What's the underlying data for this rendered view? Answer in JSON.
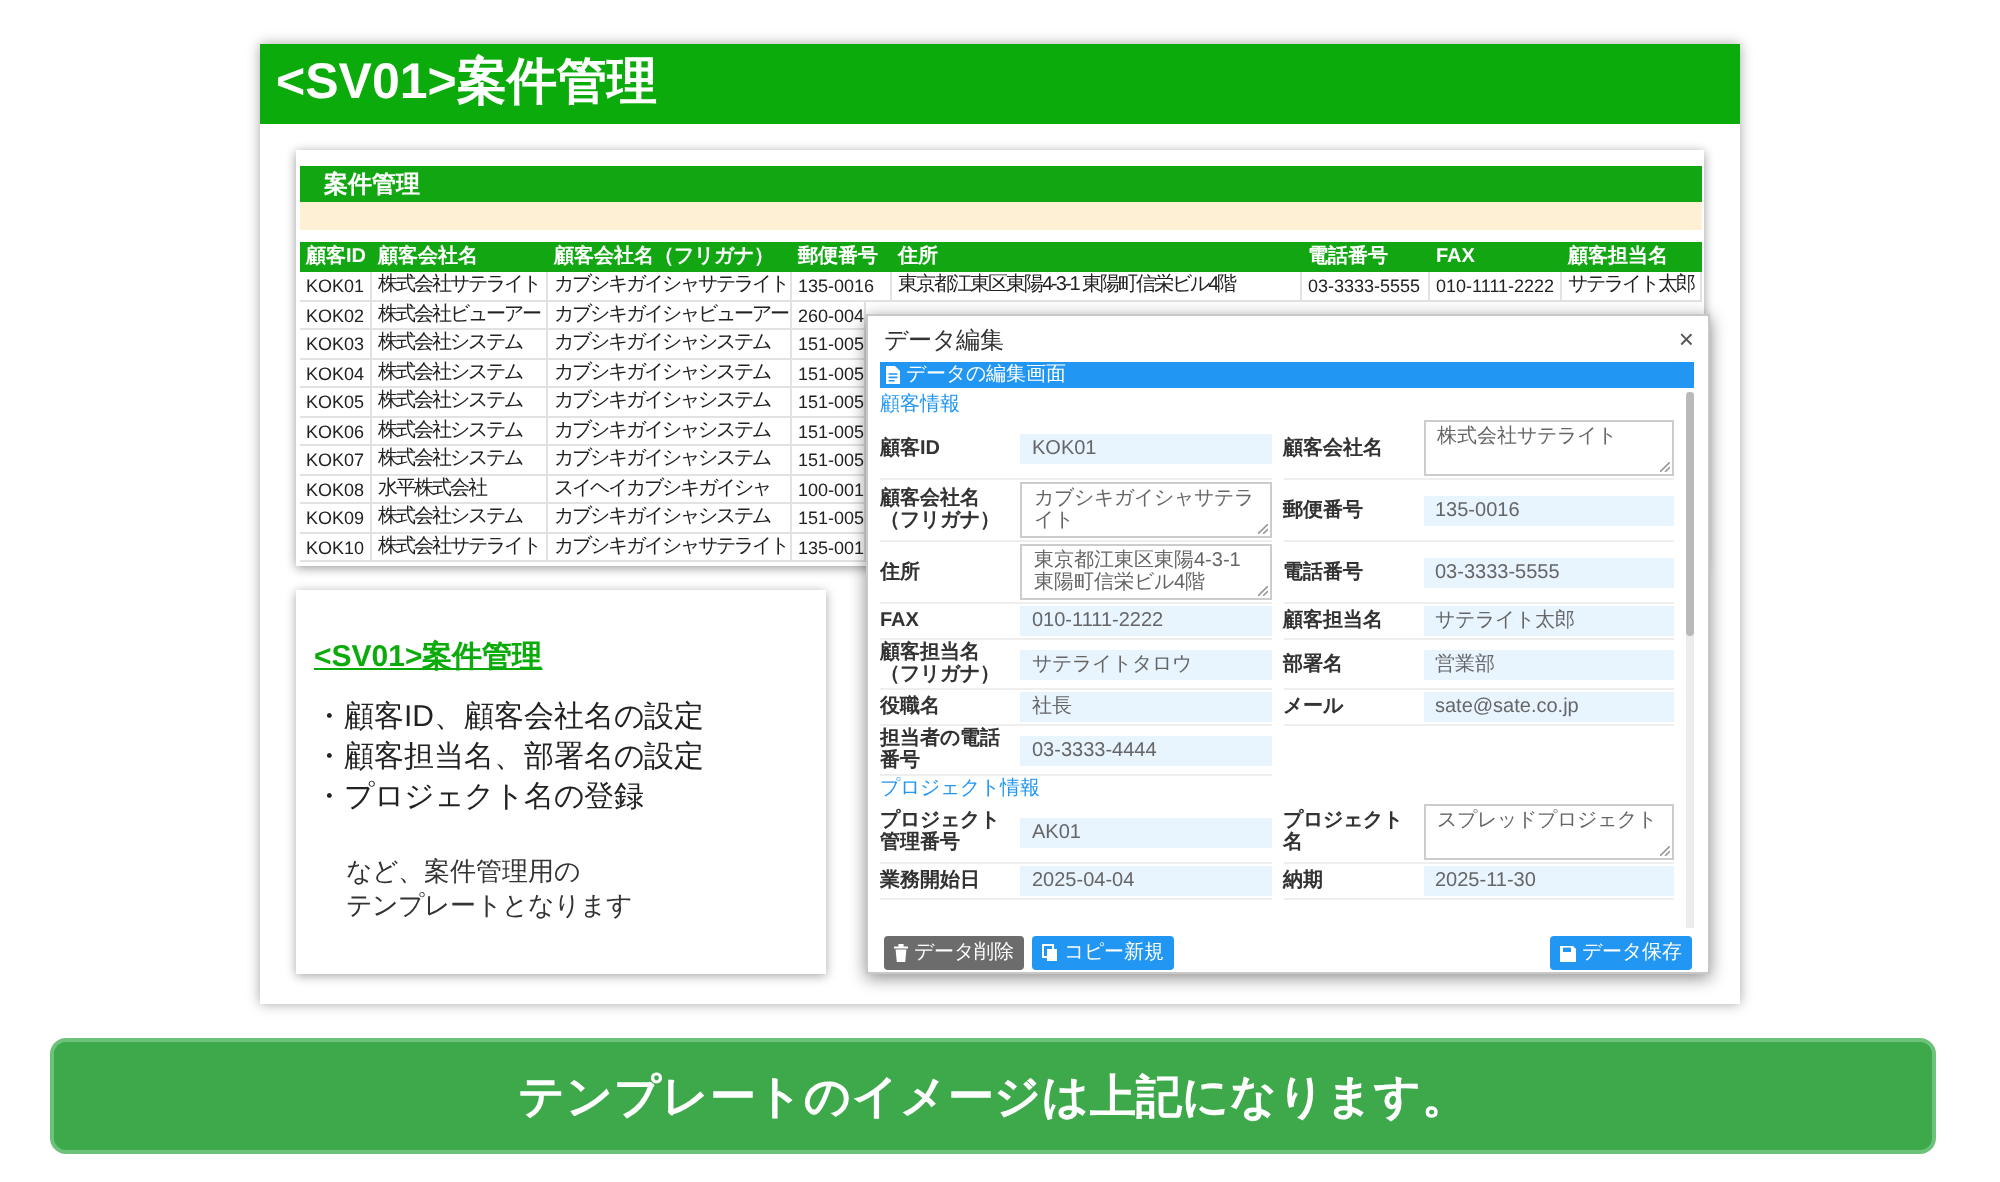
{
  "header": {
    "title": "<SV01>案件管理"
  },
  "sheet": {
    "title": "案件管理",
    "columns": [
      "顧客ID",
      "顧客会社名",
      "顧客会社名（フリガナ）",
      "郵便番号",
      "住所",
      "電話番号",
      "FAX",
      "顧客担当名"
    ],
    "rows": [
      {
        "cells": [
          "KOK01",
          "株式会社サテライト",
          "カブシキガイシャサテライト",
          "135-0016",
          "東京都江東区東陽4-3-1 東陽町信栄ビル4階",
          "03-3333-5555",
          "010-1111-2222",
          "サテライト太郎"
        ]
      },
      {
        "cells": [
          "KOK02",
          "株式会社ビューアー",
          "カブシキガイシャビューアー",
          "260-004"
        ]
      },
      {
        "cells": [
          "KOK03",
          "株式会社システム",
          "カブシキガイシャシステム",
          "151-005"
        ]
      },
      {
        "cells": [
          "KOK04",
          "株式会社システム",
          "カブシキガイシャシステム",
          "151-005"
        ]
      },
      {
        "cells": [
          "KOK05",
          "株式会社システム",
          "カブシキガイシャシステム",
          "151-005"
        ]
      },
      {
        "cells": [
          "KOK06",
          "株式会社システム",
          "カブシキガイシャシステム",
          "151-005"
        ]
      },
      {
        "cells": [
          "KOK07",
          "株式会社システム",
          "カブシキガイシャシステム",
          "151-005"
        ]
      },
      {
        "cells": [
          "KOK08",
          "水平株式会社",
          "スイヘイカブシキガイシャ",
          "100-001"
        ]
      },
      {
        "cells": [
          "KOK09",
          "株式会社システム",
          "カブシキガイシャシステム",
          "151-005"
        ]
      },
      {
        "cells": [
          "KOK10",
          "株式会社サテライト",
          "カブシキガイシャサテライト",
          "135-001"
        ]
      }
    ]
  },
  "summary": {
    "title": "<SV01>案件管理",
    "features": [
      "・顧客ID、顧客会社名の設定",
      "・顧客担当名、部署名の設定",
      "・プロジェクト名の登録"
    ],
    "note_lines": [
      "など、案件管理用の",
      "テンプレートとなります"
    ]
  },
  "dialog": {
    "title": "データ編集",
    "close": "×",
    "banner": "データの編集画面",
    "sections": [
      {
        "title": "顧客情報",
        "fields": [
          {
            "label": "顧客ID",
            "value": "KOK01",
            "kind": "input"
          },
          {
            "label": "顧客会社名",
            "value": "株式会社サテライト",
            "kind": "textarea"
          },
          {
            "label": "顧客会社名（フリガナ）",
            "value": "カブシキガイシャサテライト",
            "kind": "textarea"
          },
          {
            "label": "郵便番号",
            "value": "135-0016",
            "kind": "input"
          },
          {
            "label": "住所",
            "value": "東京都江東区東陽4-3-1 東陽町信栄ビル4階",
            "kind": "textarea"
          },
          {
            "label": "電話番号",
            "value": "03-3333-5555",
            "kind": "input"
          },
          {
            "label": "FAX",
            "value": "010-1111-2222",
            "kind": "input"
          },
          {
            "label": "顧客担当名",
            "value": "サテライト太郎",
            "kind": "input"
          },
          {
            "label": "顧客担当名（フリガナ）",
            "value": "サテライトタロウ",
            "kind": "input"
          },
          {
            "label": "部署名",
            "value": "営業部",
            "kind": "input"
          },
          {
            "label": "役職名",
            "value": "社長",
            "kind": "input"
          },
          {
            "label": "メール",
            "value": "sate@sate.co.jp",
            "kind": "input"
          },
          {
            "label": "担当者の電話番号",
            "value": "03-3333-4444",
            "kind": "input"
          }
        ]
      },
      {
        "title": "プロジェクト情報",
        "fields": [
          {
            "label": "プロジェクト管理番号",
            "value": "AK01",
            "kind": "input"
          },
          {
            "label": "プロジェクト名",
            "value": "スプレッドプロジェクト",
            "kind": "textarea"
          },
          {
            "label": "業務開始日",
            "value": "2025-04-04",
            "kind": "input"
          },
          {
            "label": "納期",
            "value": "2025-11-30",
            "kind": "input"
          }
        ]
      }
    ],
    "buttons": [
      {
        "label": "データ削除",
        "kind": "delete"
      },
      {
        "label": "コピー新規",
        "kind": "copy"
      },
      {
        "label": "データ保存",
        "kind": "save"
      }
    ]
  },
  "banner": {
    "text": "テンプレートのイメージは上記になります。"
  }
}
